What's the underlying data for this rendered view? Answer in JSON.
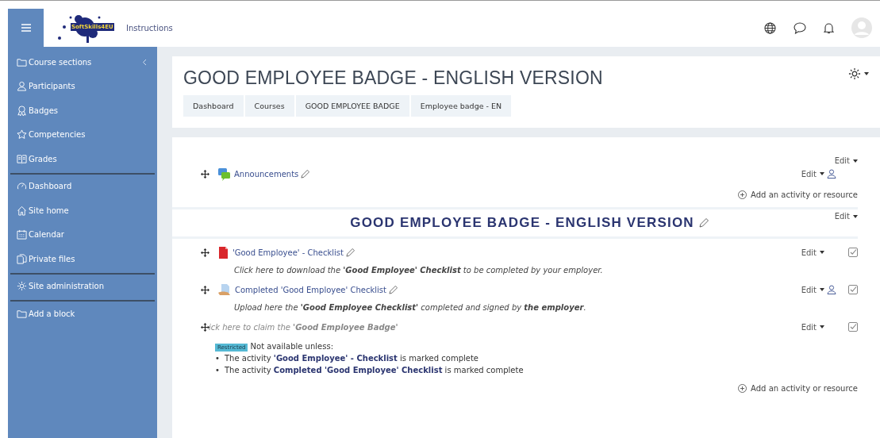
{
  "navbar": {
    "logo_text": "SoftSkills4EU",
    "site_name": "Instructions"
  },
  "sidebar": {
    "groups": [
      [
        {
          "label": "Course sections"
        },
        {
          "label": "Participants"
        },
        {
          "label": "Badges"
        },
        {
          "label": "Competencies"
        },
        {
          "label": "Grades"
        }
      ],
      [
        {
          "label": "Dashboard"
        },
        {
          "label": "Site home"
        },
        {
          "label": "Calendar"
        },
        {
          "label": "Private files"
        }
      ],
      [
        {
          "label": "Site administration"
        }
      ],
      [
        {
          "label": "Add a block"
        }
      ]
    ]
  },
  "header": {
    "title": "GOOD EMPLOYEE BADGE - ENGLISH VERSION",
    "breadcrumbs": [
      "Dashboard",
      "Courses",
      "GOOD EMPLOYEE BADGE",
      "Employee badge - EN"
    ]
  },
  "sections": [
    {
      "edit": "Edit",
      "add_activity": "Add an activity or resource",
      "activities": [
        {
          "kind": "forum",
          "name": "Announcements",
          "edit": "Edit",
          "group_mode": true
        }
      ]
    },
    {
      "title": "GOOD EMPLOYEE BADGE - ENGLISH VERSION",
      "edit": "Edit",
      "add_activity": "Add an activity or resource",
      "activities": [
        {
          "kind": "pdf",
          "name": "'Good Employee' - Checklist",
          "edit": "Edit",
          "group_mode": false,
          "completed": false,
          "description": "Click here to download the **'Good Employee' Checklist** to be completed by your employer."
        },
        {
          "kind": "assign",
          "name": "Completed 'Good Employee' Checklist",
          "edit": "Edit",
          "group_mode": true,
          "completed": false,
          "description": "Upload here the **'Good Employee Checklist'** completed and signed by **the employer**."
        },
        {
          "kind": "label",
          "name": "ick here to claim the **'Good Employee Badge'**",
          "edit": "Edit",
          "group_mode": false,
          "completed": false,
          "restriction": {
            "badge": "Restricted",
            "intro": "Not available unless:",
            "conditions": [
              {
                "marker": "•",
                "before": "The activity",
                "activity": "'Good Employee' - Checklist",
                "after": "is marked complete"
              },
              {
                "marker": "•",
                "before": "The activity",
                "activity": "Completed 'Good Employee' Checklist",
                "after": "is marked complete"
              }
            ]
          }
        }
      ]
    }
  ]
}
